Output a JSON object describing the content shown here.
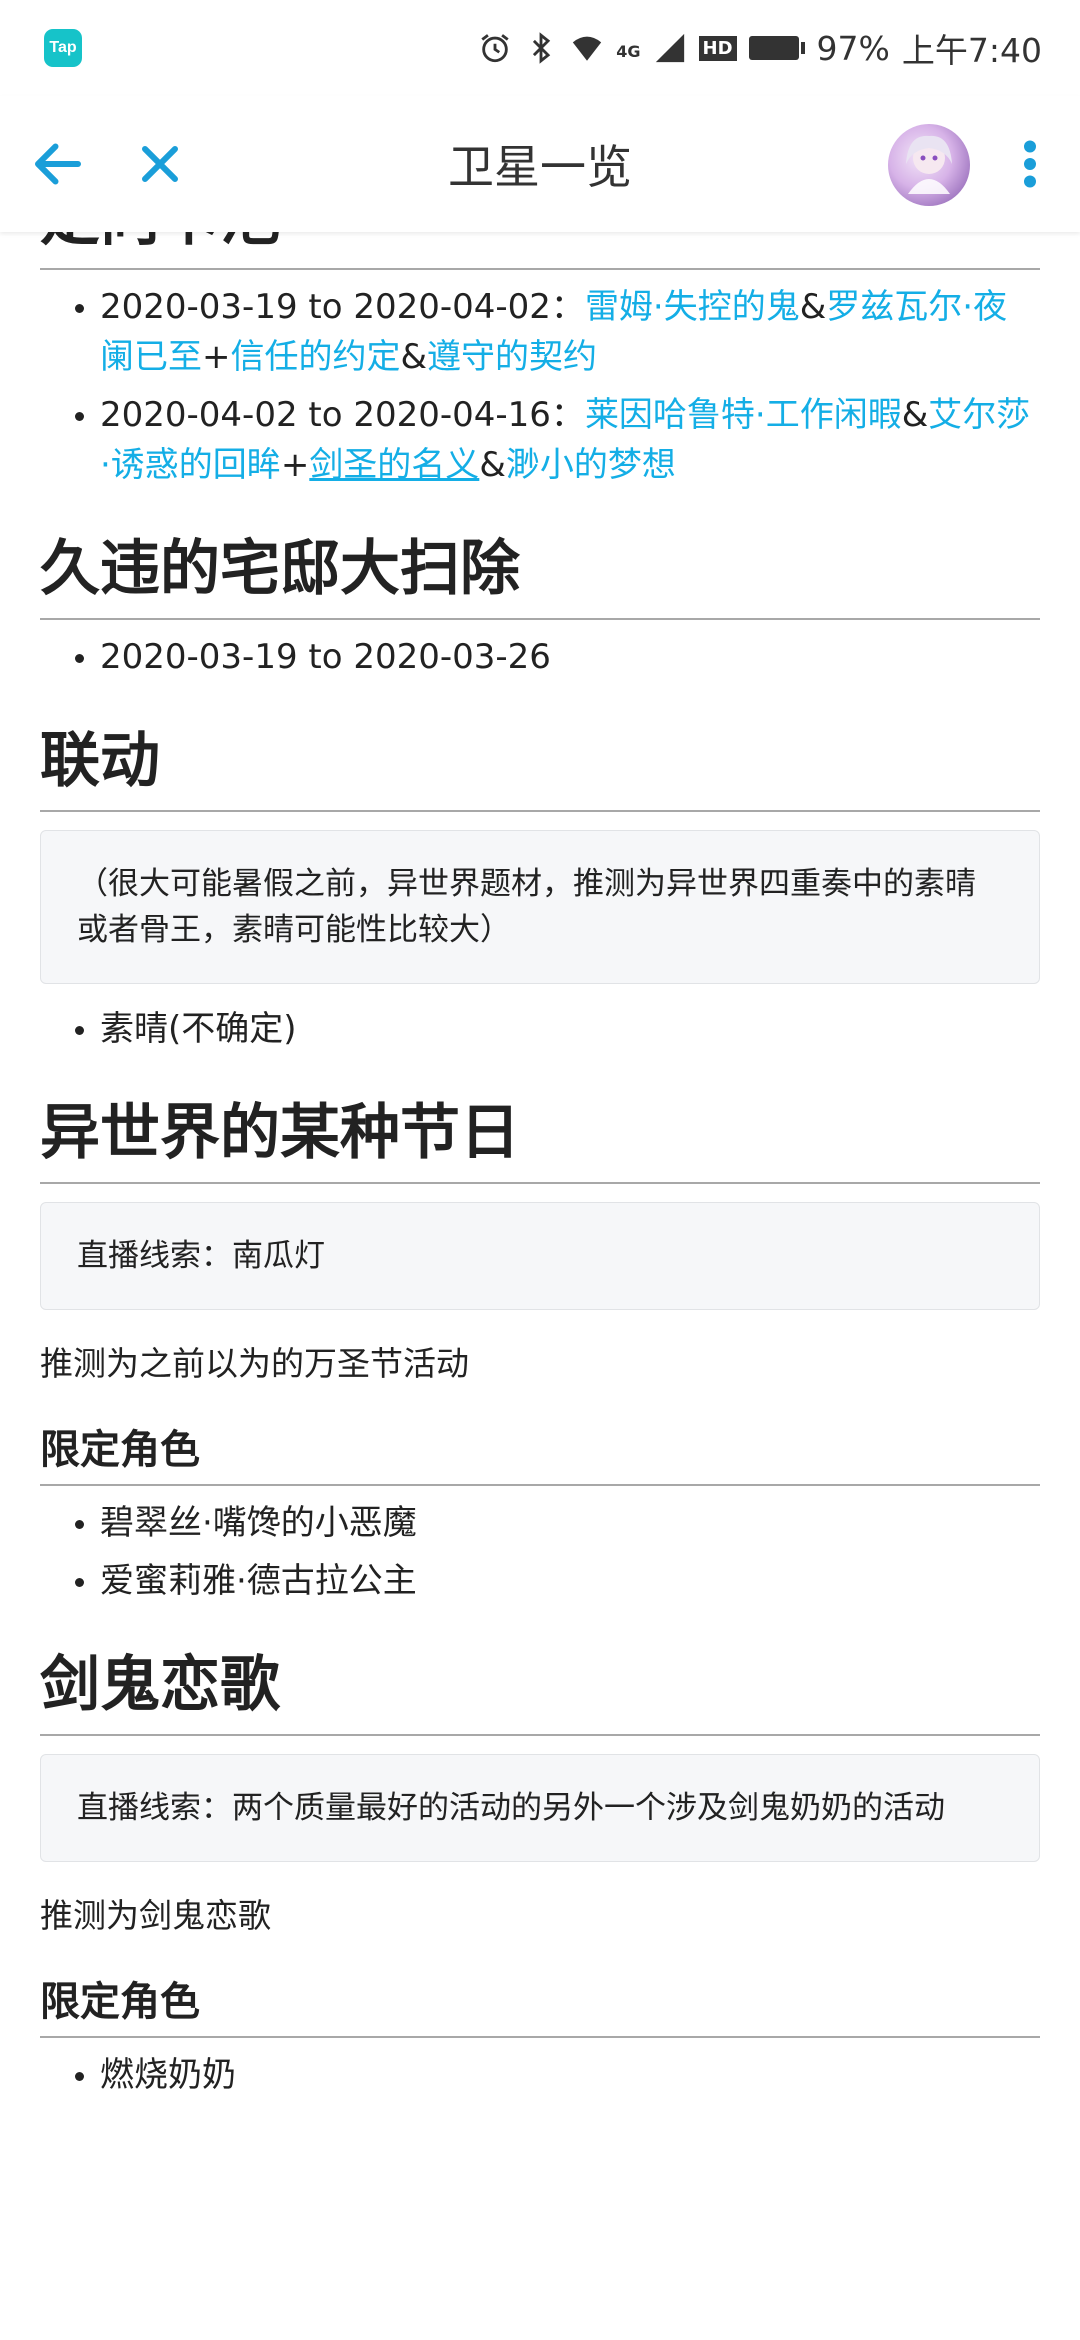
{
  "status_bar": {
    "app_logo_text": "Tap",
    "battery": "97%",
    "time": "上午7:40",
    "network": "4G",
    "hd": "HD"
  },
  "app_bar": {
    "title": "卫星一览"
  },
  "section_partial": {
    "title_partial": "定向卡池",
    "items": [
      {
        "date": "2020-03-19 to 2020-04-02：",
        "l1": "雷姆·失控的鬼",
        "s1": "&",
        "l2": "罗兹瓦尔·夜阑已至",
        "s2": "+",
        "l3": "信任的约定",
        "s3": "&",
        "l4": "遵守的契约"
      },
      {
        "date": "2020-04-02 to 2020-04-16：",
        "l1": "莱因哈鲁特·工作闲暇",
        "s1": "&",
        "l2": "艾尔莎·诱惑的回眸",
        "s2": "+",
        "l3": "剑圣的名义",
        "s3": "&",
        "l4": "渺小的梦想"
      }
    ]
  },
  "section_cleaning": {
    "title": "久违的宅邸大扫除",
    "items": [
      "2020-03-19 to 2020-03-26"
    ]
  },
  "section_collab": {
    "title": "联动",
    "note": "（很大可能暑假之前，异世界题材，推测为异世界四重奏中的素晴或者骨王，素晴可能性比较大）",
    "items": [
      "素晴(不确定)"
    ]
  },
  "section_festival": {
    "title": "异世界的某种节日",
    "note": "直播线索：南瓜灯",
    "guess": "推测为之前以为的万圣节活动",
    "limited_title": "限定角色",
    "items": [
      "碧翠丝·嘴馋的小恶魔",
      "爱蜜莉雅·德古拉公主"
    ]
  },
  "section_sword": {
    "title": "剑鬼恋歌",
    "note": "直播线索：两个质量最好的活动的另外一个涉及剑鬼奶奶的活动",
    "guess": "推测为剑鬼恋歌",
    "limited_title": "限定角色",
    "items": [
      "燃烧奶奶"
    ]
  },
  "colors": {
    "link": "#14aee6",
    "accent": "#1a9ed9",
    "logo": "#16c3c9"
  },
  "icons": {
    "back": "arrow-left-icon",
    "close": "close-icon",
    "more": "more-vertical-icon",
    "alarm": "alarm-icon",
    "bluetooth": "bluetooth-icon",
    "wifi": "wifi-icon",
    "signal": "signal-icon",
    "battery": "battery-icon"
  }
}
